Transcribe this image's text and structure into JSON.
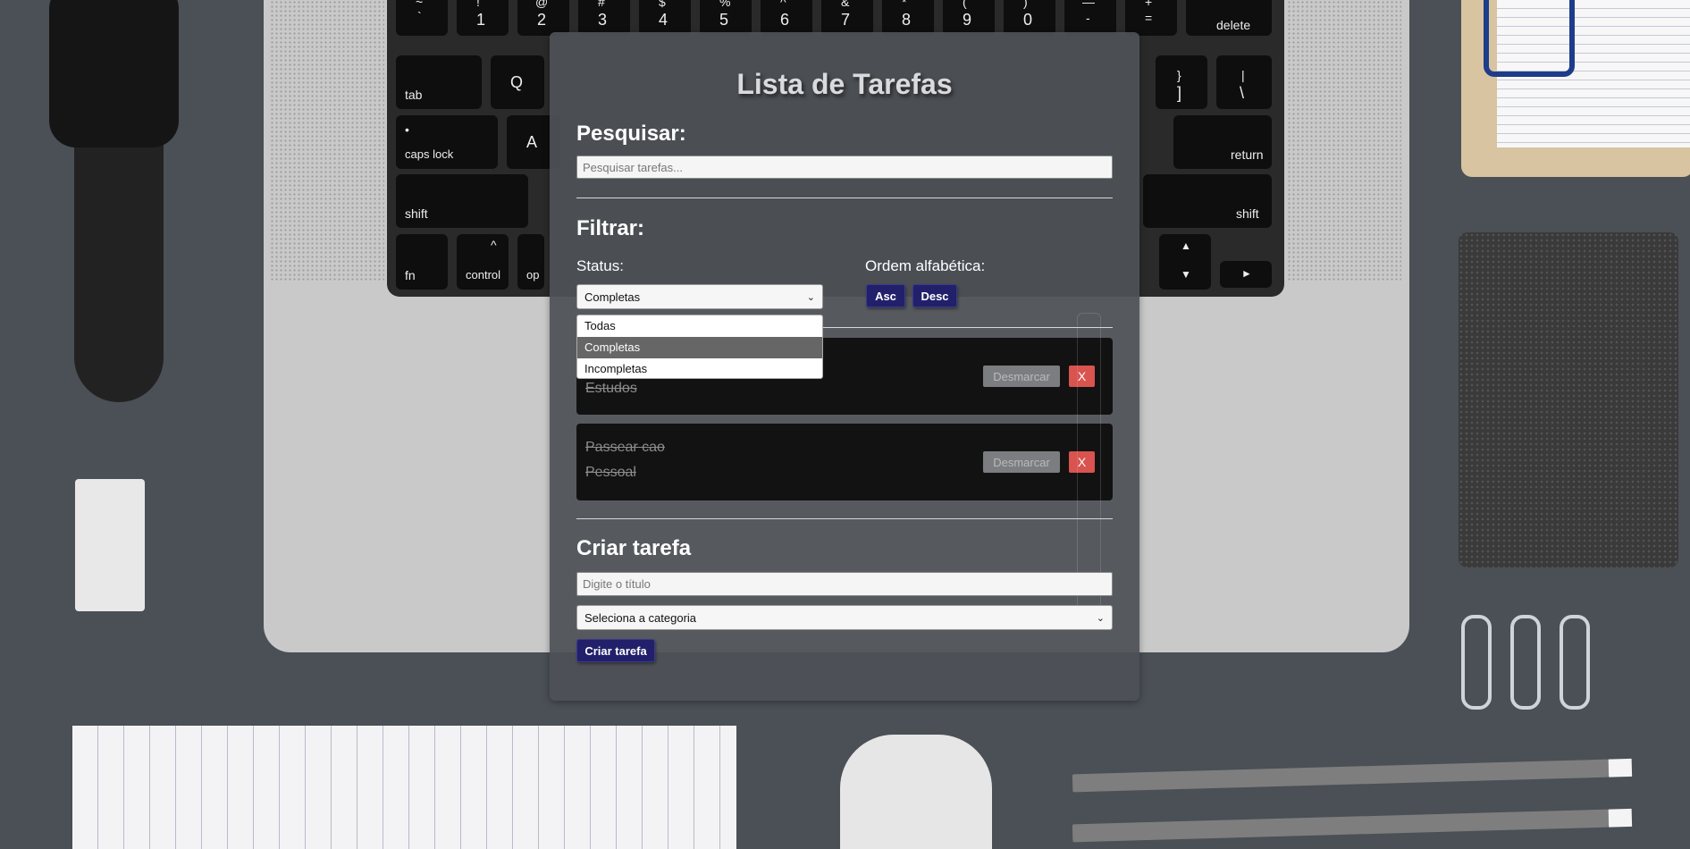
{
  "app": {
    "title": "Lista de Tarefas",
    "search": {
      "heading": "Pesquisar:",
      "placeholder": "Pesquisar tarefas...",
      "value": ""
    },
    "filter": {
      "heading": "Filtrar:",
      "status_label": "Status:",
      "status_selected": "Completas",
      "status_options": [
        "Todas",
        "Completas",
        "Incompletas"
      ],
      "highlighted_option": "Completas",
      "sort_label": "Ordem alfabética:",
      "asc_label": "Asc",
      "desc_label": "Desc"
    },
    "tasks": [
      {
        "category": "Estudos",
        "completed": true,
        "toggle_label": "Desmarcar",
        "delete_label": "X"
      },
      {
        "title": "Passear cao",
        "category": "Pessoal",
        "completed": true,
        "toggle_label": "Desmarcar",
        "delete_label": "X"
      }
    ],
    "create": {
      "heading": "Criar tarefa",
      "title_placeholder": "Digite o título",
      "category_placeholder": "Seleciona a categoria",
      "submit_label": "Criar tarefa"
    }
  },
  "colors": {
    "panel": "#4e5257",
    "task_bg": "#121212",
    "primary_button": "#22206a",
    "delete_button": "#d9534f",
    "unmark_button": "#7b7d80"
  },
  "background_keys": [
    {
      "label": "~",
      "sub": "`"
    },
    {
      "label": "!",
      "sub": "1"
    },
    {
      "label": "@",
      "sub": "2"
    },
    {
      "label": "#",
      "sub": "3"
    },
    {
      "label": "$",
      "sub": "4"
    },
    {
      "label": "%",
      "sub": "5"
    },
    {
      "label": "^",
      "sub": "6"
    },
    {
      "label": "&",
      "sub": "7"
    },
    {
      "label": "*",
      "sub": "8"
    },
    {
      "label": "(",
      "sub": "9"
    },
    {
      "label": ")",
      "sub": "0"
    },
    {
      "label": "—",
      "sub": "-"
    },
    {
      "label": "+",
      "sub": "="
    },
    {
      "label": "delete",
      "sub": ""
    },
    {
      "label": "tab",
      "sub": ""
    },
    {
      "label": "Q",
      "sub": ""
    },
    {
      "label": "}",
      "sub": "]"
    },
    {
      "label": "|",
      "sub": "\\"
    },
    {
      "label": "•",
      "sub": "caps lock"
    },
    {
      "label": "A",
      "sub": ""
    },
    {
      "label": "return",
      "sub": ""
    },
    {
      "label": "shift",
      "sub": ""
    },
    {
      "label": "shift",
      "sub": ""
    },
    {
      "label": "fn",
      "sub": ""
    },
    {
      "label": "^",
      "sub": "control"
    },
    {
      "label": "op",
      "sub": ""
    },
    {
      "label": "▲",
      "sub": "▼"
    },
    {
      "label": "►",
      "sub": ""
    }
  ]
}
